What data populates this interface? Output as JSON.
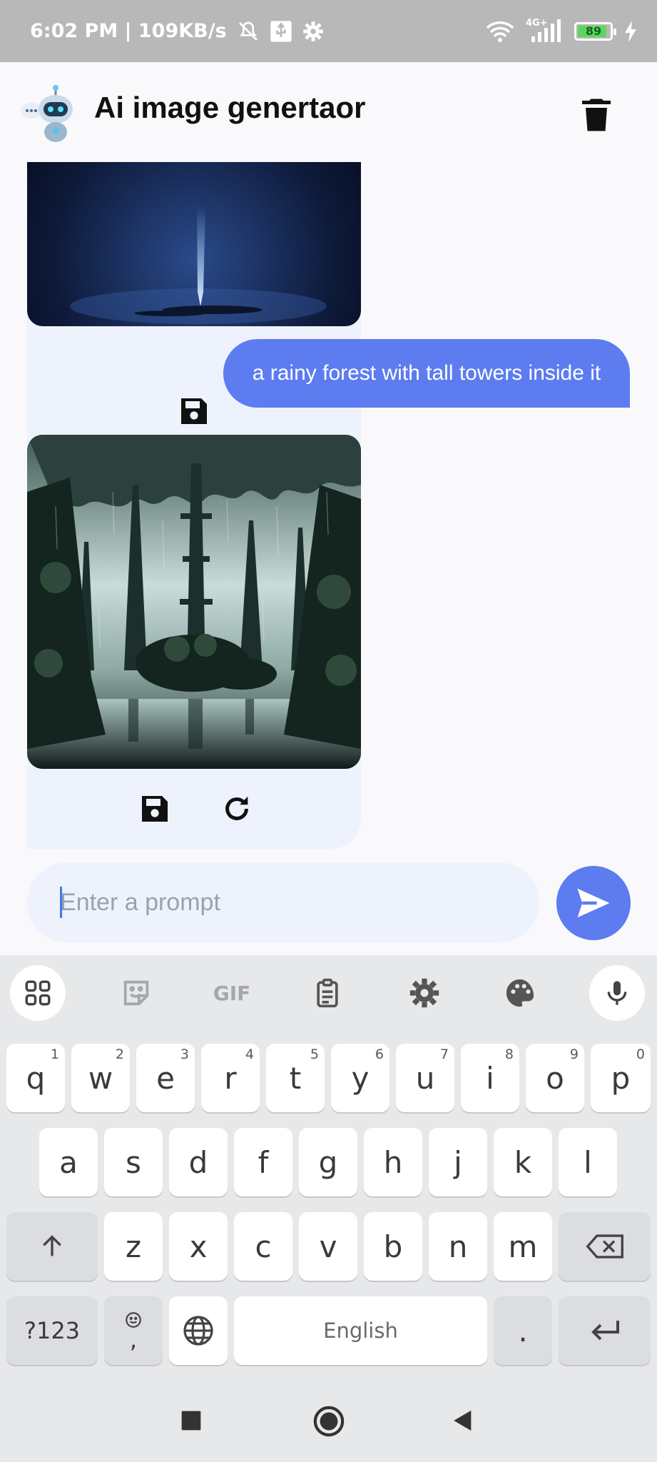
{
  "status_bar": {
    "time_speed": "6:02 PM | 109KB/s",
    "network_label": "4G+",
    "battery_level": "89"
  },
  "app": {
    "title": "Ai image genertaor"
  },
  "chat": {
    "messages": [
      {
        "role": "user",
        "text": "a rainy forest with tall towers inside it"
      }
    ]
  },
  "input": {
    "placeholder": "Enter a prompt",
    "value": ""
  },
  "keyboard": {
    "row1": [
      {
        "key": "q",
        "hint": "1"
      },
      {
        "key": "w",
        "hint": "2"
      },
      {
        "key": "e",
        "hint": "3"
      },
      {
        "key": "r",
        "hint": "4"
      },
      {
        "key": "t",
        "hint": "5"
      },
      {
        "key": "y",
        "hint": "6"
      },
      {
        "key": "u",
        "hint": "7"
      },
      {
        "key": "i",
        "hint": "8"
      },
      {
        "key": "o",
        "hint": "9"
      },
      {
        "key": "p",
        "hint": "0"
      }
    ],
    "row2": [
      "a",
      "s",
      "d",
      "f",
      "g",
      "h",
      "j",
      "k",
      "l"
    ],
    "row3": [
      "z",
      "x",
      "c",
      "v",
      "b",
      "n",
      "m"
    ],
    "symbols_label": "?123",
    "comma_label": ",",
    "space_label": "English",
    "period_label": ".",
    "toolbar_gif_label": "GIF"
  },
  "colors": {
    "accent": "#5c7cf0",
    "bubble_bg": "#eef2fd",
    "status_bar_bg": "#b8b8b8",
    "keyboard_bg": "#e7e8ea"
  },
  "icons": [
    "wifi-icon",
    "signal-icon",
    "battery-icon",
    "usb-icon",
    "settings-icon",
    "mute-icon",
    "trash-icon",
    "save-icon",
    "regenerate-icon",
    "send-icon",
    "mic-icon",
    "palette-icon",
    "clipboard-icon",
    "sticker-icon",
    "apps-grid-icon",
    "shift-icon",
    "backspace-icon",
    "enter-icon",
    "globe-icon",
    "emoji-icon"
  ]
}
